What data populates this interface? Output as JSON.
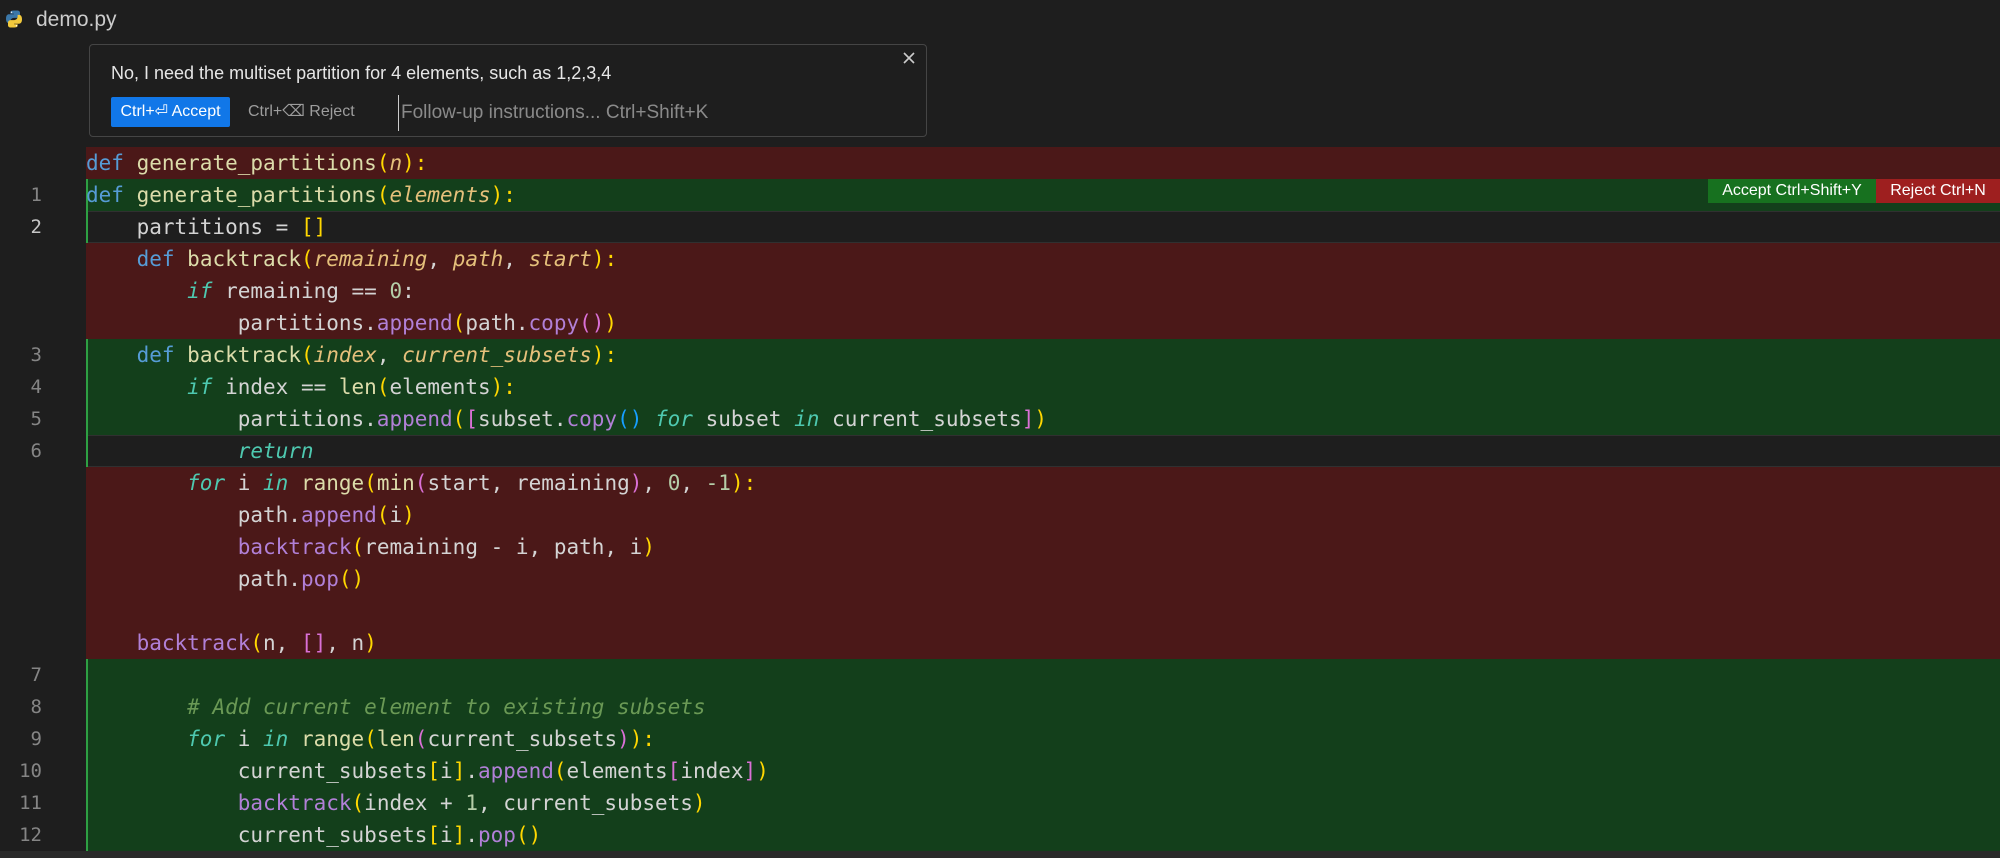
{
  "tab": {
    "title": "demo.py",
    "icon": "python-icon"
  },
  "prompt": {
    "text": "No, I need the multiset partition for 4 elements, such as 1,2,3,4",
    "accept_label": "Ctrl+⏎ Accept",
    "reject_label": "Ctrl+⌫ Reject",
    "followup_placeholder": "Follow-up instructions... Ctrl+Shift+K",
    "followup_value": ""
  },
  "diff_actions": {
    "accept_label": "Accept Ctrl+Shift+Y",
    "reject_label": "Reject Ctrl+N"
  },
  "colors": {
    "keyword": "#569cd6",
    "control": "#4ec9b0",
    "function": "#dcdcaa",
    "method": "#b180d7",
    "param": "#e5c07b",
    "string_number": "#b5cea8",
    "comment": "#6a9955",
    "bracket_gold": "#ffd700",
    "bracket_pink": "#da70d6",
    "bracket_blue": "#179fff",
    "added_bg": "#133f1b",
    "deleted_bg": "#4b1818"
  },
  "code_lines": [
    {
      "kind": "del",
      "num": "",
      "tokens": [
        [
          "def",
          "kw"
        ],
        [
          " ",
          ""
        ],
        [
          "generate_partitions",
          "fn"
        ],
        [
          "(",
          "b1"
        ],
        [
          "n",
          "par"
        ],
        [
          "):",
          "b1"
        ]
      ]
    },
    {
      "kind": "add",
      "num": "1",
      "tokens": [
        [
          "def",
          "kw"
        ],
        [
          " ",
          ""
        ],
        [
          "generate_partitions",
          "fn"
        ],
        [
          "(",
          "b1"
        ],
        [
          "elements",
          "par"
        ],
        [
          "):",
          "b1"
        ]
      ]
    },
    {
      "kind": "plain cur",
      "num": "2",
      "active": true,
      "tokens": [
        [
          "    partitions = ",
          ""
        ],
        [
          "[]",
          "b1"
        ]
      ]
    },
    {
      "kind": "del",
      "num": "",
      "tokens": [
        [
          "    ",
          ""
        ],
        [
          "def",
          "kw"
        ],
        [
          " ",
          ""
        ],
        [
          "backtrack",
          "fn"
        ],
        [
          "(",
          "b1"
        ],
        [
          "remaining",
          "par"
        ],
        [
          ", ",
          ""
        ],
        [
          "path",
          "par"
        ],
        [
          ", ",
          ""
        ],
        [
          "start",
          "par"
        ],
        [
          "):",
          "b1"
        ]
      ]
    },
    {
      "kind": "del",
      "num": "",
      "tokens": [
        [
          "        ",
          ""
        ],
        [
          "if",
          "ctl"
        ],
        [
          " remaining == ",
          ""
        ],
        [
          "0",
          "num"
        ],
        [
          ":",
          ""
        ]
      ]
    },
    {
      "kind": "del",
      "num": "",
      "tokens": [
        [
          "            partitions.",
          ""
        ],
        [
          "append",
          "meth"
        ],
        [
          "(",
          "b1"
        ],
        [
          "path.",
          ""
        ],
        [
          "copy",
          "meth"
        ],
        [
          "()",
          "b2"
        ],
        [
          ")",
          "b1"
        ]
      ]
    },
    {
      "kind": "add",
      "num": "3",
      "tokens": [
        [
          "    ",
          ""
        ],
        [
          "def",
          "kw"
        ],
        [
          " ",
          ""
        ],
        [
          "backtrack",
          "fn"
        ],
        [
          "(",
          "b1"
        ],
        [
          "index",
          "par"
        ],
        [
          ", ",
          ""
        ],
        [
          "current_subsets",
          "par"
        ],
        [
          "):",
          "b1"
        ]
      ]
    },
    {
      "kind": "add",
      "num": "4",
      "tokens": [
        [
          "        ",
          ""
        ],
        [
          "if",
          "ctl"
        ],
        [
          " index == ",
          ""
        ],
        [
          "len",
          "fn"
        ],
        [
          "(",
          "b1"
        ],
        [
          "elements",
          ""
        ],
        [
          "):",
          "b1"
        ]
      ]
    },
    {
      "kind": "add",
      "num": "5",
      "tokens": [
        [
          "            partitions.",
          ""
        ],
        [
          "append",
          "meth"
        ],
        [
          "(",
          "b1"
        ],
        [
          "[",
          "b2"
        ],
        [
          "subset.",
          ""
        ],
        [
          "copy",
          "meth"
        ],
        [
          "()",
          "b3"
        ],
        [
          " ",
          ""
        ],
        [
          "for",
          "ctl"
        ],
        [
          " subset ",
          ""
        ],
        [
          "in",
          "ctl"
        ],
        [
          " current_subsets",
          ""
        ],
        [
          "]",
          "b2"
        ],
        [
          ")",
          "b1"
        ]
      ]
    },
    {
      "kind": "plain cur",
      "num": "6",
      "tokens": [
        [
          "            ",
          ""
        ],
        [
          "return",
          "ctl"
        ]
      ]
    },
    {
      "kind": "del",
      "num": "",
      "tokens": [
        [
          "        ",
          ""
        ],
        [
          "for",
          "ctl"
        ],
        [
          " i ",
          ""
        ],
        [
          "in",
          "ctl"
        ],
        [
          " ",
          ""
        ],
        [
          "range",
          "fn"
        ],
        [
          "(",
          "b1"
        ],
        [
          "min",
          "fn"
        ],
        [
          "(",
          "b2"
        ],
        [
          "start, remaining",
          ""
        ],
        [
          ")",
          "b2"
        ],
        [
          ", ",
          ""
        ],
        [
          "0",
          "num"
        ],
        [
          ", ",
          ""
        ],
        [
          "-1",
          "num"
        ],
        [
          "):",
          "b1"
        ]
      ]
    },
    {
      "kind": "del",
      "num": "",
      "tokens": [
        [
          "            path.",
          ""
        ],
        [
          "append",
          "meth"
        ],
        [
          "(",
          "b1"
        ],
        [
          "i",
          ""
        ],
        [
          ")",
          "b1"
        ]
      ]
    },
    {
      "kind": "del",
      "num": "",
      "tokens": [
        [
          "            ",
          ""
        ],
        [
          "backtrack",
          "meth"
        ],
        [
          "(",
          "b1"
        ],
        [
          "remaining - i, path, i",
          ""
        ],
        [
          ")",
          "b1"
        ]
      ]
    },
    {
      "kind": "del",
      "num": "",
      "tokens": [
        [
          "            path.",
          ""
        ],
        [
          "pop",
          "meth"
        ],
        [
          "()",
          "b1"
        ]
      ]
    },
    {
      "kind": "del",
      "num": "",
      "tokens": [
        [
          "",
          ""
        ]
      ]
    },
    {
      "kind": "del",
      "num": "",
      "tokens": [
        [
          "    ",
          ""
        ],
        [
          "backtrack",
          "meth"
        ],
        [
          "(",
          "b1"
        ],
        [
          "n, ",
          ""
        ],
        [
          "[]",
          "b2"
        ],
        [
          ", n",
          ""
        ],
        [
          ")",
          "b1"
        ]
      ]
    },
    {
      "kind": "add",
      "num": "7",
      "tokens": [
        [
          "",
          ""
        ]
      ]
    },
    {
      "kind": "add",
      "num": "8",
      "tokens": [
        [
          "        ",
          ""
        ],
        [
          "# Add current element to existing subsets",
          "cm"
        ]
      ]
    },
    {
      "kind": "add",
      "num": "9",
      "tokens": [
        [
          "        ",
          ""
        ],
        [
          "for",
          "ctl"
        ],
        [
          " i ",
          ""
        ],
        [
          "in",
          "ctl"
        ],
        [
          " ",
          ""
        ],
        [
          "range",
          "fn"
        ],
        [
          "(",
          "b1"
        ],
        [
          "len",
          "fn"
        ],
        [
          "(",
          "b2"
        ],
        [
          "current_subsets",
          ""
        ],
        [
          ")",
          "b2"
        ],
        [
          "):",
          "b1"
        ]
      ]
    },
    {
      "kind": "add",
      "num": "10",
      "tokens": [
        [
          "            current_subsets",
          ""
        ],
        [
          "[",
          "b1"
        ],
        [
          "i",
          ""
        ],
        [
          "]",
          "b1"
        ],
        [
          ".",
          ""
        ],
        [
          "append",
          "meth"
        ],
        [
          "(",
          "b1"
        ],
        [
          "elements",
          ""
        ],
        [
          "[",
          "b2"
        ],
        [
          "index",
          ""
        ],
        [
          "]",
          "b2"
        ],
        [
          ")",
          "b1"
        ]
      ]
    },
    {
      "kind": "add",
      "num": "11",
      "tokens": [
        [
          "            ",
          ""
        ],
        [
          "backtrack",
          "meth"
        ],
        [
          "(",
          "b1"
        ],
        [
          "index + ",
          ""
        ],
        [
          "1",
          "num"
        ],
        [
          ", current_subsets",
          ""
        ],
        [
          ")",
          "b1"
        ]
      ]
    },
    {
      "kind": "add",
      "num": "12",
      "tokens": [
        [
          "            current_subsets",
          ""
        ],
        [
          "[",
          "b1"
        ],
        [
          "i",
          ""
        ],
        [
          "]",
          "b1"
        ],
        [
          ".",
          ""
        ],
        [
          "pop",
          "meth"
        ],
        [
          "()",
          "b1"
        ]
      ]
    }
  ]
}
